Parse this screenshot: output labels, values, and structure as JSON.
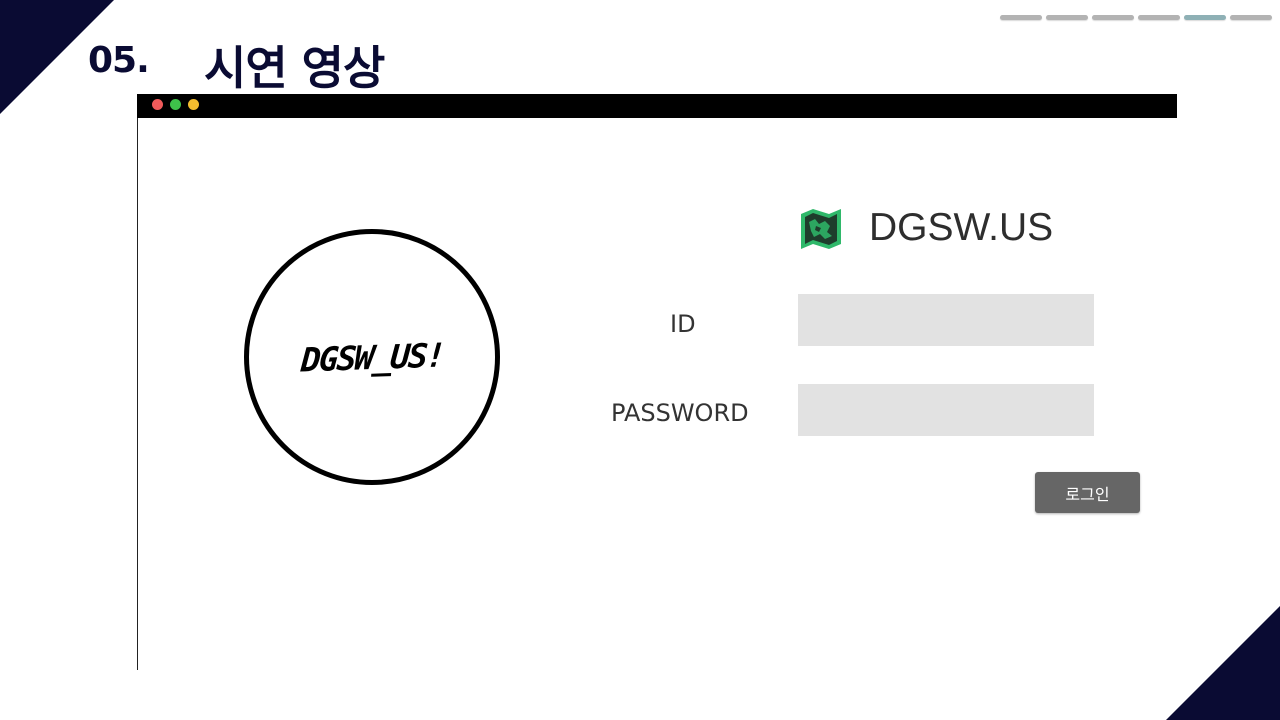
{
  "slide": {
    "number": "05.",
    "title": "시연 영상",
    "progress": {
      "total": 6,
      "active_index": 4,
      "active_color": "#8eb0b5",
      "inactive_color": "#b3b3b3"
    },
    "accent_color": "#0a0b33"
  },
  "window": {
    "bar_color": "#000000",
    "traffic_lights": [
      "#f15b5b",
      "#3ec24a",
      "#f4bd2f"
    ]
  },
  "app": {
    "logo_text": "DGSW_US!",
    "brand_name": "DGSW.US",
    "brand_icon": "map-icon",
    "brand_icon_color": "#2fb86a",
    "form": {
      "id_label": "ID",
      "id_value": "",
      "password_label": "PASSWORD",
      "password_value": "",
      "login_label": "로그인"
    }
  }
}
